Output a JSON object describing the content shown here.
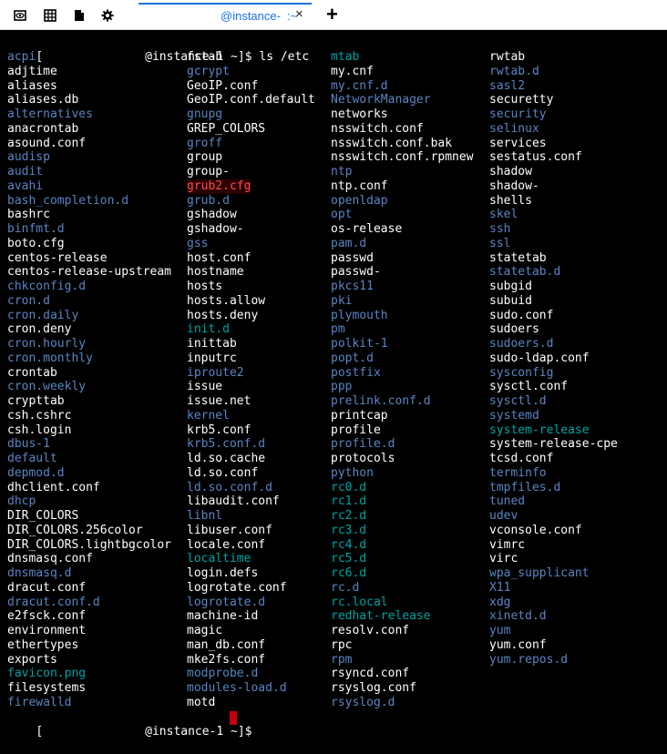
{
  "toolbar": {
    "icons": [
      "eye-icon",
      "grid-icon",
      "file-icon",
      "gear-icon"
    ]
  },
  "tab": {
    "title": "@instance-  :~",
    "close": "×"
  },
  "new_tab": "+",
  "terminal": {
    "prompt_host": "@instance-1 ~]$ ",
    "command": "ls /etc",
    "prompt_end": "@instance-1 ~]$ ",
    "prompt_open": "[",
    "columns": [
      [
        {
          "t": "acpi",
          "c": "blue"
        },
        {
          "t": "adjtime",
          "c": "white"
        },
        {
          "t": "aliases",
          "c": "white"
        },
        {
          "t": "aliases.db",
          "c": "white"
        },
        {
          "t": "alternatives",
          "c": "blue"
        },
        {
          "t": "anacrontab",
          "c": "white"
        },
        {
          "t": "asound.conf",
          "c": "white"
        },
        {
          "t": "audisp",
          "c": "blue"
        },
        {
          "t": "audit",
          "c": "blue"
        },
        {
          "t": "avahi",
          "c": "blue"
        },
        {
          "t": "bash_completion.d",
          "c": "blue"
        },
        {
          "t": "bashrc",
          "c": "white"
        },
        {
          "t": "binfmt.d",
          "c": "blue"
        },
        {
          "t": "boto.cfg",
          "c": "white"
        },
        {
          "t": "centos-release",
          "c": "white"
        },
        {
          "t": "centos-release-upstream",
          "c": "white"
        },
        {
          "t": "chkconfig.d",
          "c": "blue"
        },
        {
          "t": "cron.d",
          "c": "blue"
        },
        {
          "t": "cron.daily",
          "c": "blue"
        },
        {
          "t": "cron.deny",
          "c": "white"
        },
        {
          "t": "cron.hourly",
          "c": "blue"
        },
        {
          "t": "cron.monthly",
          "c": "blue"
        },
        {
          "t": "crontab",
          "c": "white"
        },
        {
          "t": "cron.weekly",
          "c": "blue"
        },
        {
          "t": "crypttab",
          "c": "white"
        },
        {
          "t": "csh.cshrc",
          "c": "white"
        },
        {
          "t": "csh.login",
          "c": "white"
        },
        {
          "t": "dbus-1",
          "c": "blue"
        },
        {
          "t": "default",
          "c": "blue"
        },
        {
          "t": "depmod.d",
          "c": "blue"
        },
        {
          "t": "dhclient.conf",
          "c": "white"
        },
        {
          "t": "dhcp",
          "c": "blue"
        },
        {
          "t": "DIR_COLORS",
          "c": "white"
        },
        {
          "t": "DIR_COLORS.256color",
          "c": "white"
        },
        {
          "t": "DIR_COLORS.lightbgcolor",
          "c": "white"
        },
        {
          "t": "dnsmasq.conf",
          "c": "white"
        },
        {
          "t": "dnsmasq.d",
          "c": "blue"
        },
        {
          "t": "dracut.conf",
          "c": "white"
        },
        {
          "t": "dracut.conf.d",
          "c": "blue"
        },
        {
          "t": "e2fsck.conf",
          "c": "white"
        },
        {
          "t": "environment",
          "c": "white"
        },
        {
          "t": "ethertypes",
          "c": "white"
        },
        {
          "t": "exports",
          "c": "white"
        },
        {
          "t": "favicon.png",
          "c": "cyan"
        },
        {
          "t": "filesystems",
          "c": "white"
        },
        {
          "t": "firewalld",
          "c": "blue"
        }
      ],
      [
        {
          "t": "fstab",
          "c": "white"
        },
        {
          "t": "gcrypt",
          "c": "blue"
        },
        {
          "t": "GeoIP.conf",
          "c": "white"
        },
        {
          "t": "GeoIP.conf.default",
          "c": "white"
        },
        {
          "t": "gnupg",
          "c": "blue"
        },
        {
          "t": "GREP_COLORS",
          "c": "white"
        },
        {
          "t": "groff",
          "c": "blue"
        },
        {
          "t": "group",
          "c": "white"
        },
        {
          "t": "group-",
          "c": "white"
        },
        {
          "t": "grub2.cfg",
          "c": "grub"
        },
        {
          "t": "grub.d",
          "c": "blue"
        },
        {
          "t": "gshadow",
          "c": "white"
        },
        {
          "t": "gshadow-",
          "c": "white"
        },
        {
          "t": "gss",
          "c": "blue"
        },
        {
          "t": "host.conf",
          "c": "white"
        },
        {
          "t": "hostname",
          "c": "white"
        },
        {
          "t": "hosts",
          "c": "white"
        },
        {
          "t": "hosts.allow",
          "c": "white"
        },
        {
          "t": "hosts.deny",
          "c": "white"
        },
        {
          "t": "init.d",
          "c": "cyan"
        },
        {
          "t": "inittab",
          "c": "white"
        },
        {
          "t": "inputrc",
          "c": "white"
        },
        {
          "t": "iproute2",
          "c": "blue"
        },
        {
          "t": "issue",
          "c": "white"
        },
        {
          "t": "issue.net",
          "c": "white"
        },
        {
          "t": "kernel",
          "c": "blue"
        },
        {
          "t": "krb5.conf",
          "c": "white"
        },
        {
          "t": "krb5.conf.d",
          "c": "blue"
        },
        {
          "t": "ld.so.cache",
          "c": "white"
        },
        {
          "t": "ld.so.conf",
          "c": "white"
        },
        {
          "t": "ld.so.conf.d",
          "c": "blue"
        },
        {
          "t": "libaudit.conf",
          "c": "white"
        },
        {
          "t": "libnl",
          "c": "blue"
        },
        {
          "t": "libuser.conf",
          "c": "white"
        },
        {
          "t": "locale.conf",
          "c": "white"
        },
        {
          "t": "localtime",
          "c": "cyan"
        },
        {
          "t": "login.defs",
          "c": "white"
        },
        {
          "t": "logrotate.conf",
          "c": "white"
        },
        {
          "t": "logrotate.d",
          "c": "blue"
        },
        {
          "t": "machine-id",
          "c": "white"
        },
        {
          "t": "magic",
          "c": "white"
        },
        {
          "t": "man_db.conf",
          "c": "white"
        },
        {
          "t": "mke2fs.conf",
          "c": "white"
        },
        {
          "t": "modprobe.d",
          "c": "blue"
        },
        {
          "t": "modules-load.d",
          "c": "blue"
        },
        {
          "t": "motd",
          "c": "white"
        }
      ],
      [
        {
          "t": "mtab",
          "c": "cyan"
        },
        {
          "t": "my.cnf",
          "c": "white"
        },
        {
          "t": "my.cnf.d",
          "c": "blue"
        },
        {
          "t": "NetworkManager",
          "c": "blue"
        },
        {
          "t": "networks",
          "c": "white"
        },
        {
          "t": "nsswitch.conf",
          "c": "white"
        },
        {
          "t": "nsswitch.conf.bak",
          "c": "white"
        },
        {
          "t": "nsswitch.conf.rpmnew",
          "c": "white"
        },
        {
          "t": "ntp",
          "c": "blue"
        },
        {
          "t": "ntp.conf",
          "c": "white"
        },
        {
          "t": "openldap",
          "c": "blue"
        },
        {
          "t": "opt",
          "c": "blue"
        },
        {
          "t": "os-release",
          "c": "white"
        },
        {
          "t": "pam.d",
          "c": "blue"
        },
        {
          "t": "passwd",
          "c": "white"
        },
        {
          "t": "passwd-",
          "c": "white"
        },
        {
          "t": "pkcs11",
          "c": "blue"
        },
        {
          "t": "pki",
          "c": "blue"
        },
        {
          "t": "plymouth",
          "c": "blue"
        },
        {
          "t": "pm",
          "c": "blue"
        },
        {
          "t": "polkit-1",
          "c": "blue"
        },
        {
          "t": "popt.d",
          "c": "blue"
        },
        {
          "t": "postfix",
          "c": "blue"
        },
        {
          "t": "ppp",
          "c": "blue"
        },
        {
          "t": "prelink.conf.d",
          "c": "blue"
        },
        {
          "t": "printcap",
          "c": "white"
        },
        {
          "t": "profile",
          "c": "white"
        },
        {
          "t": "profile.d",
          "c": "blue"
        },
        {
          "t": "protocols",
          "c": "white"
        },
        {
          "t": "python",
          "c": "blue"
        },
        {
          "t": "rc0.d",
          "c": "cyan"
        },
        {
          "t": "rc1.d",
          "c": "cyan"
        },
        {
          "t": "rc2.d",
          "c": "cyan"
        },
        {
          "t": "rc3.d",
          "c": "cyan"
        },
        {
          "t": "rc4.d",
          "c": "cyan"
        },
        {
          "t": "rc5.d",
          "c": "cyan"
        },
        {
          "t": "rc6.d",
          "c": "cyan"
        },
        {
          "t": "rc.d",
          "c": "blue"
        },
        {
          "t": "rc.local",
          "c": "cyan"
        },
        {
          "t": "redhat-release",
          "c": "cyan"
        },
        {
          "t": "resolv.conf",
          "c": "white"
        },
        {
          "t": "rpc",
          "c": "white"
        },
        {
          "t": "rpm",
          "c": "blue"
        },
        {
          "t": "rsyncd.conf",
          "c": "white"
        },
        {
          "t": "rsyslog.conf",
          "c": "white"
        },
        {
          "t": "rsyslog.d",
          "c": "blue"
        }
      ],
      [
        {
          "t": "rwtab",
          "c": "white"
        },
        {
          "t": "rwtab.d",
          "c": "blue"
        },
        {
          "t": "sasl2",
          "c": "blue"
        },
        {
          "t": "securetty",
          "c": "white"
        },
        {
          "t": "security",
          "c": "blue"
        },
        {
          "t": "selinux",
          "c": "blue"
        },
        {
          "t": "services",
          "c": "white"
        },
        {
          "t": "sestatus.conf",
          "c": "white"
        },
        {
          "t": "shadow",
          "c": "white"
        },
        {
          "t": "shadow-",
          "c": "white"
        },
        {
          "t": "shells",
          "c": "white"
        },
        {
          "t": "skel",
          "c": "blue"
        },
        {
          "t": "ssh",
          "c": "blue"
        },
        {
          "t": "ssl",
          "c": "blue"
        },
        {
          "t": "statetab",
          "c": "white"
        },
        {
          "t": "statetab.d",
          "c": "blue"
        },
        {
          "t": "subgid",
          "c": "white"
        },
        {
          "t": "subuid",
          "c": "white"
        },
        {
          "t": "sudo.conf",
          "c": "white"
        },
        {
          "t": "sudoers",
          "c": "white"
        },
        {
          "t": "sudoers.d",
          "c": "blue"
        },
        {
          "t": "sudo-ldap.conf",
          "c": "white"
        },
        {
          "t": "sysconfig",
          "c": "blue"
        },
        {
          "t": "sysctl.conf",
          "c": "white"
        },
        {
          "t": "sysctl.d",
          "c": "blue"
        },
        {
          "t": "systemd",
          "c": "blue"
        },
        {
          "t": "system-release",
          "c": "cyan"
        },
        {
          "t": "system-release-cpe",
          "c": "white"
        },
        {
          "t": "tcsd.conf",
          "c": "white"
        },
        {
          "t": "terminfo",
          "c": "blue"
        },
        {
          "t": "tmpfiles.d",
          "c": "blue"
        },
        {
          "t": "tuned",
          "c": "blue"
        },
        {
          "t": "udev",
          "c": "blue"
        },
        {
          "t": "vconsole.conf",
          "c": "white"
        },
        {
          "t": "vimrc",
          "c": "white"
        },
        {
          "t": "virc",
          "c": "white"
        },
        {
          "t": "wpa_supplicant",
          "c": "blue"
        },
        {
          "t": "X11",
          "c": "blue"
        },
        {
          "t": "xdg",
          "c": "blue"
        },
        {
          "t": "xinetd.d",
          "c": "blue"
        },
        {
          "t": "yum",
          "c": "blue"
        },
        {
          "t": "yum.conf",
          "c": "white"
        },
        {
          "t": "yum.repos.d",
          "c": "blue"
        }
      ]
    ]
  }
}
